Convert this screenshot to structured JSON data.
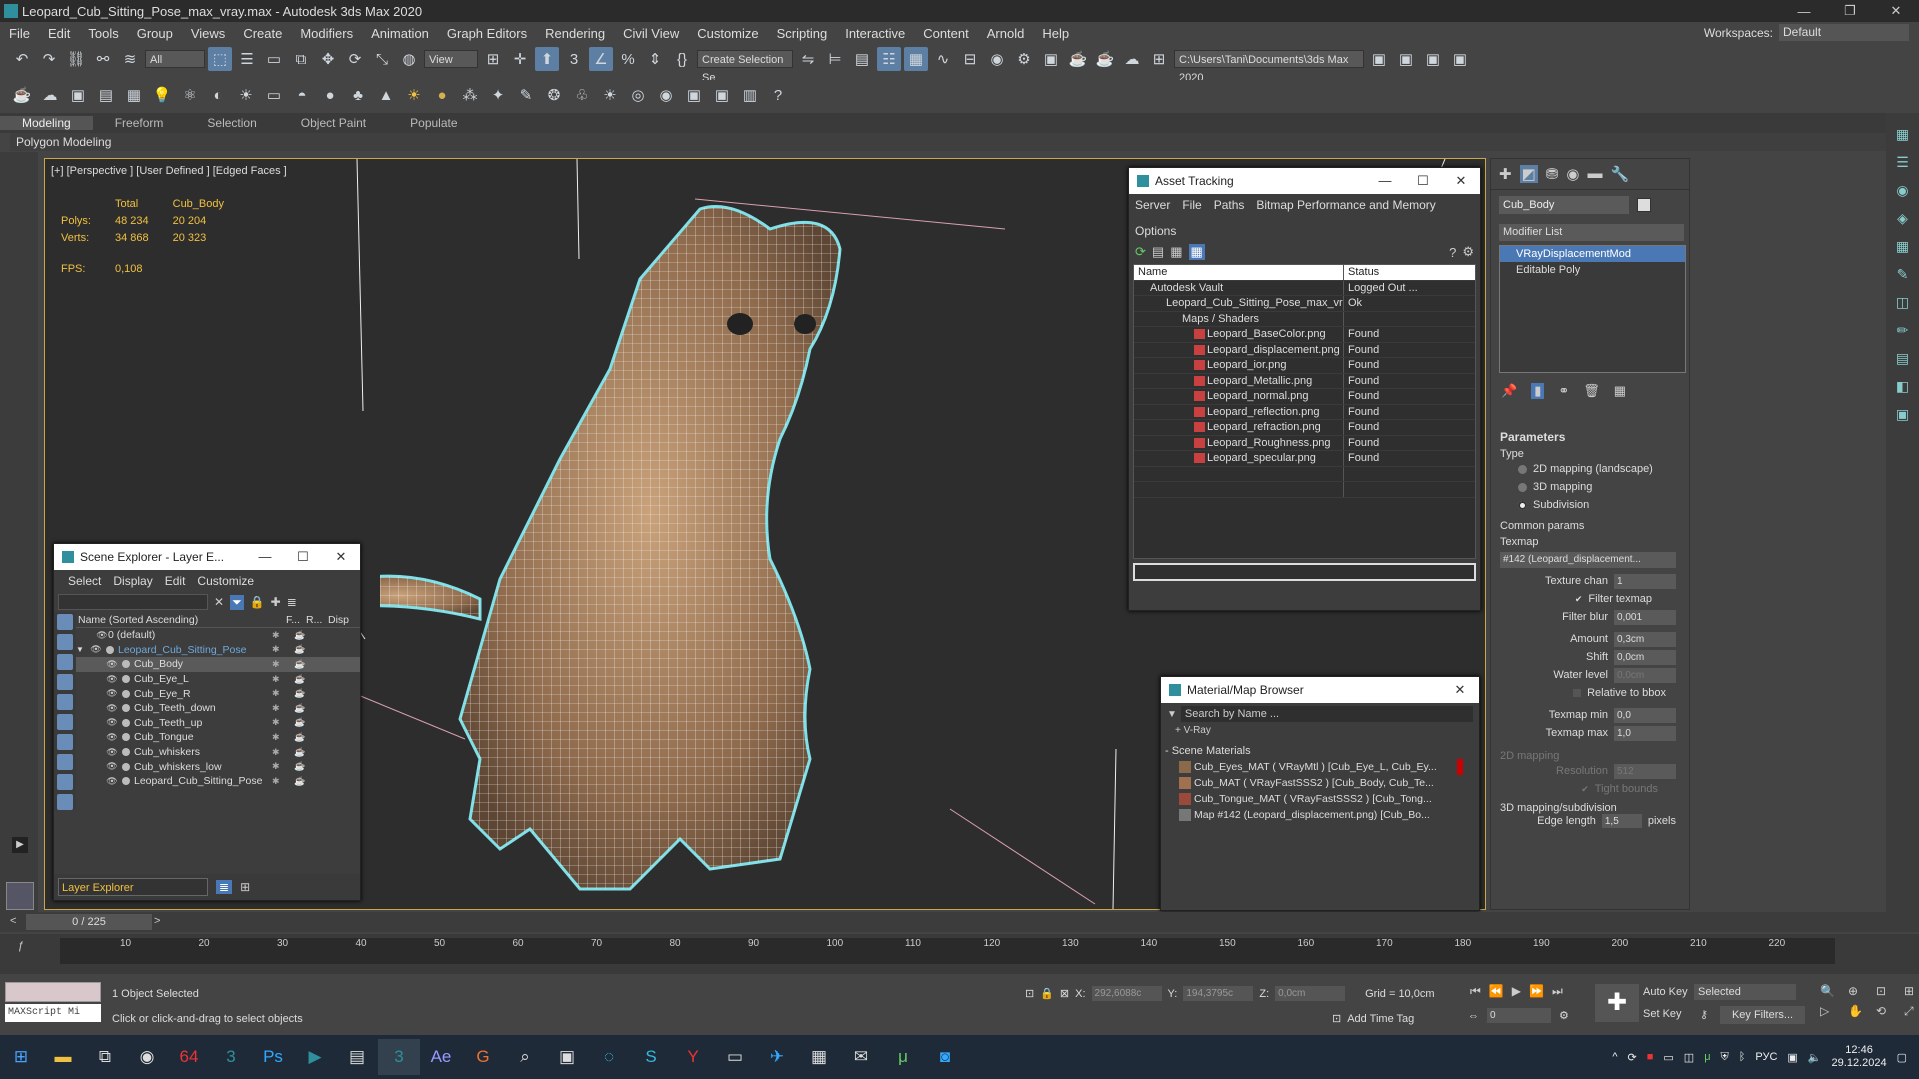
{
  "window": {
    "title": "Leopard_Cub_Sitting_Pose_max_vray.max - Autodesk 3ds Max 2020",
    "minimize": "—",
    "maximize": "❐",
    "close": "✕"
  },
  "menu": [
    "File",
    "Edit",
    "Tools",
    "Group",
    "Views",
    "Create",
    "Modifiers",
    "Animation",
    "Graph Editors",
    "Rendering",
    "Civil View",
    "Customize",
    "Scripting",
    "Interactive",
    "Content",
    "Arnold",
    "Help"
  ],
  "workspaces": {
    "label": "Workspaces:",
    "value": "Default"
  },
  "toolbar": {
    "filter": "All",
    "refcoord": "View",
    "selset": "Create Selection Se",
    "path": "C:\\Users\\Tani\\Documents\\3ds Max 2020"
  },
  "ribbon": {
    "tabs": [
      "Modeling",
      "Freeform",
      "Selection",
      "Object Paint",
      "Populate"
    ],
    "sub": "Polygon Modeling"
  },
  "viewport": {
    "label": "[+] [Perspective ] [User Defined ] [Edged Faces ]",
    "stats": {
      "h_total": "Total",
      "h_obj": "Cub_Body",
      "polys_label": "Polys:",
      "polys_total": "48 234",
      "polys_obj": "20 204",
      "verts_label": "Verts:",
      "verts_total": "34 868",
      "verts_obj": "20 323",
      "fps_label": "FPS:",
      "fps": "0,108"
    }
  },
  "asset_tracking": {
    "title": "Asset Tracking",
    "menu": [
      "Server",
      "File",
      "Paths",
      "Bitmap Performance and Memory",
      "Options"
    ],
    "col_name": "Name",
    "col_status": "Status",
    "rows": [
      {
        "name": "Autodesk Vault",
        "status": "Logged Out ..."
      },
      {
        "name": "Leopard_Cub_Sitting_Pose_max_vra...",
        "status": "Ok"
      },
      {
        "name": "Maps / Shaders",
        "status": ""
      },
      {
        "name": "Leopard_BaseColor.png",
        "status": "Found"
      },
      {
        "name": "Leopard_displacement.png",
        "status": "Found"
      },
      {
        "name": "Leopard_ior.png",
        "status": "Found"
      },
      {
        "name": "Leopard_Metallic.png",
        "status": "Found"
      },
      {
        "name": "Leopard_normal.png",
        "status": "Found"
      },
      {
        "name": "Leopard_reflection.png",
        "status": "Found"
      },
      {
        "name": "Leopard_refraction.png",
        "status": "Found"
      },
      {
        "name": "Leopard_Roughness.png",
        "status": "Found"
      },
      {
        "name": "Leopard_specular.png",
        "status": "Found"
      }
    ]
  },
  "scene_explorer": {
    "title": "Scene Explorer - Layer E...",
    "menu": [
      "Select",
      "Display",
      "Edit",
      "Customize"
    ],
    "col_name": "Name (Sorted Ascending)",
    "col_f": "F...",
    "col_r": "R...",
    "col_d": "Disp",
    "rows": [
      {
        "name": "0 (default)",
        "indent": 1
      },
      {
        "name": "Leopard_Cub_Sitting_Pose",
        "indent": 0
      },
      {
        "name": "Cub_Body",
        "indent": 2
      },
      {
        "name": "Cub_Eye_L",
        "indent": 2
      },
      {
        "name": "Cub_Eye_R",
        "indent": 2
      },
      {
        "name": "Cub_Teeth_down",
        "indent": 2
      },
      {
        "name": "Cub_Teeth_up",
        "indent": 2
      },
      {
        "name": "Cub_Tongue",
        "indent": 2
      },
      {
        "name": "Cub_whiskers",
        "indent": 2
      },
      {
        "name": "Cub_whiskers_low",
        "indent": 2
      },
      {
        "name": "Leopard_Cub_Sitting_Pose",
        "indent": 2
      }
    ],
    "footer": "Layer Explorer"
  },
  "material_browser": {
    "title": "Material/Map Browser",
    "search": "Search by Name ...",
    "vray": "+ V-Ray",
    "section": "- Scene Materials",
    "items": [
      {
        "label": "Cub_Eyes_MAT  ( VRayMtl )  [Cub_Eye_L, Cub_Ey...",
        "color": "#8a6a4a"
      },
      {
        "label": "Cub_MAT  ( VRayFastSSS2 )  [Cub_Body, Cub_Te...",
        "color": "#a07050"
      },
      {
        "label": "Cub_Tongue_MAT  ( VRayFastSSS2 )  [Cub_Tong...",
        "color": "#9a4a3a"
      },
      {
        "label": "Map #142 (Leopard_displacement.png) [Cub_Bo...",
        "color": "#777777"
      }
    ]
  },
  "command_panel": {
    "object_name": "Cub_Body",
    "modifier_list": "Modifier List",
    "stack": [
      "VRayDisplacementMod",
      "Editable Poly"
    ],
    "params": {
      "header": "Parameters",
      "type_label": "Type",
      "types": [
        "2D mapping (landscape)",
        "3D mapping",
        "Subdivision"
      ],
      "common": "Common params",
      "texmap_label": "Texmap",
      "texmap": "#142 (Leopard_displacement...",
      "texture_chan_label": "Texture chan",
      "texture_chan": "1",
      "filter_texmap": "Filter texmap",
      "filter_blur_label": "Filter blur",
      "filter_blur": "0,001",
      "amount_label": "Amount",
      "amount": "0,3cm",
      "shift_label": "Shift",
      "shift": "0,0cm",
      "water_label": "Water level",
      "water": "0,0cm",
      "relative": "Relative to bbox",
      "texmin_label": "Texmap min",
      "texmin": "0,0",
      "texmax_label": "Texmap max",
      "texmax": "1,0",
      "map2d": "2D mapping",
      "resolution_label": "Resolution",
      "resolution": "512",
      "tight": "Tight bounds",
      "map3d": "3D mapping/subdivision",
      "edge_label": "Edge length",
      "edge": "1,5",
      "edge_unit": "pixels"
    }
  },
  "timeline": {
    "frame": "0 / 225",
    "ticks": [
      "10",
      "20",
      "30",
      "40",
      "50",
      "60",
      "70",
      "80",
      "90",
      "100",
      "110",
      "120",
      "130",
      "140",
      "150",
      "160",
      "170",
      "180",
      "190",
      "200",
      "210",
      "220"
    ]
  },
  "status": {
    "maxscript": "MAXScript Mi",
    "selected": "1 Object Selected",
    "prompt": "Click or click-and-drag to select objects",
    "x_label": "X:",
    "x": "292,6088c",
    "y_label": "Y:",
    "y": "194,3795c",
    "z_label": "Z:",
    "z": "0,0cm",
    "grid": "Grid = 10,0cm",
    "add_time_tag": "Add Time Tag",
    "auto_key": "Auto Key",
    "set_key": "Set Key",
    "selected_dd": "Selected",
    "key_filters": "Key Filters...",
    "frame_spin": "0"
  },
  "taskbar": {
    "lang": "РУС",
    "time": "12:46",
    "date": "29.12.2024"
  }
}
